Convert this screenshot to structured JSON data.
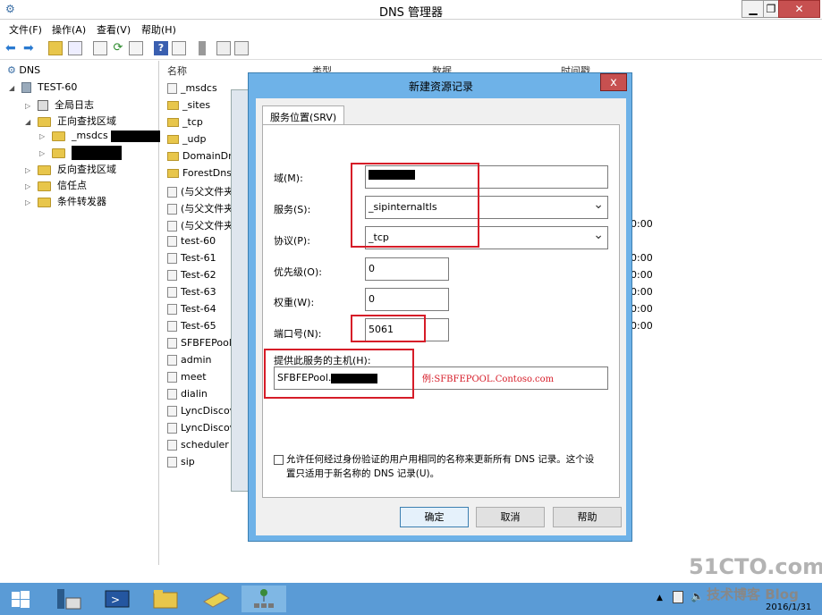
{
  "window": {
    "title": "DNS 管理器",
    "min": "▁",
    "max": "❐",
    "close": "✕"
  },
  "menu": [
    "文件(F)",
    "操作(A)",
    "查看(V)",
    "帮助(H)"
  ],
  "tree": {
    "root": "DNS",
    "server": "TEST-60",
    "global_logs": "全局日志",
    "forward_zones": "正向查找区域",
    "msdcs": "_msdcs",
    "reverse_zones": "反向查找区域",
    "trust_points": "信任点",
    "conditional_forwarders": "条件转发器"
  },
  "list": {
    "headers": [
      "名称",
      "类型",
      "数据",
      "时间戳"
    ],
    "rows": [
      {
        "name": "_msdcs",
        "icon": "zone"
      },
      {
        "name": "_sites",
        "icon": "folder"
      },
      {
        "name": "_tcp",
        "icon": "folder"
      },
      {
        "name": "_udp",
        "icon": "folder"
      },
      {
        "name": "DomainDn",
        "icon": "folder"
      },
      {
        "name": "ForestDns2",
        "icon": "folder"
      },
      {
        "name": "(与父文件夹",
        "icon": "record"
      },
      {
        "name": "(与父文件夹",
        "icon": "record"
      },
      {
        "name": "(与父文件夹",
        "icon": "record",
        "ts": "0:00"
      },
      {
        "name": "test-60",
        "icon": "record"
      },
      {
        "name": "Test-61",
        "icon": "record",
        "ts": "0:00"
      },
      {
        "name": "Test-62",
        "icon": "record",
        "ts": "0:00"
      },
      {
        "name": "Test-63",
        "icon": "record",
        "ts": "0:00"
      },
      {
        "name": "Test-64",
        "icon": "record",
        "ts": "0:00"
      },
      {
        "name": "Test-65",
        "icon": "record",
        "ts": "0:00"
      },
      {
        "name": "SFBFEPool",
        "icon": "record"
      },
      {
        "name": "admin",
        "icon": "record"
      },
      {
        "name": "meet",
        "icon": "record"
      },
      {
        "name": "dialin",
        "icon": "record"
      },
      {
        "name": "LyncDiscov",
        "icon": "record"
      },
      {
        "name": "LyncDiscov",
        "icon": "record"
      },
      {
        "name": "scheduler",
        "icon": "record"
      },
      {
        "name": "sip",
        "icon": "record"
      }
    ]
  },
  "dialog": {
    "title": "新建资源记录",
    "close": "x",
    "tab": "服务位置(SRV)",
    "domain_label": "域(M):",
    "service_label": "服务(S):",
    "service_value": "_sipinternaltls",
    "protocol_label": "协议(P):",
    "protocol_value": "_tcp",
    "priority_label": "优先级(O):",
    "priority_value": "0",
    "weight_label": "权重(W):",
    "weight_value": "0",
    "port_label": "端口号(N):",
    "port_value": "5061",
    "host_label": "提供此服务的主机(H):",
    "host_value": "SFBFEPool.",
    "host_example": "例:SFBFEPOOL.Contoso.com",
    "checkbox_text_1": "允许任何经过身份验证的用户用相同的名称来更新所有 DNS 记录。这个设",
    "checkbox_text_2": "置只适用于新名称的 DNS 记录(U)。",
    "ok": "确定",
    "cancel": "取消",
    "help": "帮助"
  },
  "taskbar": {
    "date": "2016/1/31"
  },
  "watermark": {
    "line1": "51CTO.com",
    "line2": "技术博客 Blog"
  },
  "colors": {
    "accent": "#6eb2e8",
    "highlight": "#d61c28",
    "taskbar": "#5a9bd6"
  }
}
